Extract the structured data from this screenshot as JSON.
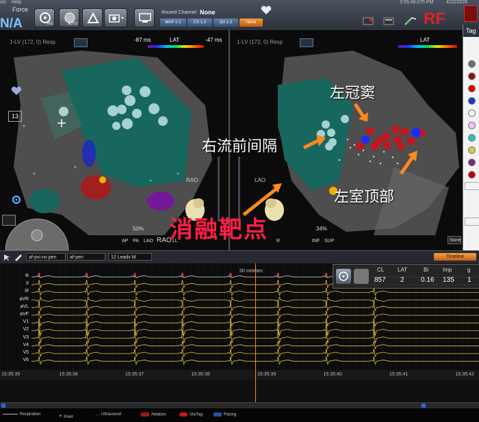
{
  "menu": {
    "item1": "ols",
    "item2": "Help"
  },
  "system": {
    "clock": "3:55:49.075 PM",
    "date": "4/22/2026",
    "force_label": "Force",
    "force_value": "N/A",
    "rf_label": "RF"
  },
  "toolbar": {
    "btn1_tag": "INS",
    "btn2_tag": "AUTO",
    "routed_label": "Routed Channel:",
    "routed_value": "None",
    "channels": [
      "MAP 1-2",
      "CS 1-2",
      "QA 1-2",
      "None"
    ]
  },
  "left_map": {
    "title": "1-LV (172, 0) Resp",
    "lat_min": "-87 ms",
    "lat_label": "LAT",
    "lat_max": "-47 ms",
    "view_label": "RAO",
    "count": "13",
    "zoom": "50%",
    "views": [
      "AP",
      "PA",
      "LAO",
      "RAO",
      "LL"
    ]
  },
  "right_map": {
    "title": "1-LV (172, 0) Resp",
    "lat_label": "LAT",
    "view_label": "LAO",
    "zoom": "34%",
    "views": [
      "R",
      "INF",
      "SUP"
    ],
    "dropdown": "None"
  },
  "annotations": {
    "rvot_septum": "右流前间隔",
    "cs": "左冠窦",
    "lv_summit": "左室顶部",
    "ablation_target": "消融靶点"
  },
  "tag_panel": {
    "title": "Tag",
    "colors": [
      "#6e6e6e",
      "#8a1010",
      "#e00000",
      "#1438d0",
      "#f6f6f6",
      "#e9c7ef",
      "#2ec0c0",
      "#d8c84a",
      "#7b2a80",
      "#c00000"
    ]
  },
  "ecg_toolbar": {
    "config1": "af-pvi no pen",
    "config2": "af-pen",
    "leads": "12 Leads M",
    "timeline": "Timeline"
  },
  "ecg": {
    "speed": "50 mm/sec",
    "leads": [
      "R",
      "II",
      "III",
      "aVR",
      "aVL",
      "aVF",
      "V1",
      "V2",
      "V3",
      "V4",
      "V5",
      "V6"
    ],
    "beat_times_s": [
      0.55,
      1.27,
      2.0,
      2.72,
      3.45,
      4.17,
      4.9,
      5.62
    ],
    "time_labels": [
      "15:35:35",
      "15:35:36",
      "15:35:37",
      "15:35:38",
      "15:35:39",
      "15:35:40",
      "15:35:41",
      "15:35:42"
    ]
  },
  "stats": {
    "headers": [
      "CL",
      "LAT",
      "Bi",
      "Imp",
      "g"
    ],
    "values": [
      "857",
      "2",
      "0.16",
      "135",
      "1"
    ]
  },
  "bottom_legend": [
    "Respiration",
    "Point",
    "Ultrasound",
    "Ablation",
    "VisiTag",
    "Pacing"
  ],
  "bottom_legend_colors": [
    "#bbbbbb",
    "#bbbbbb",
    "#bbbbbb",
    "#a01818",
    "#c81818",
    "#2a4fa0"
  ]
}
